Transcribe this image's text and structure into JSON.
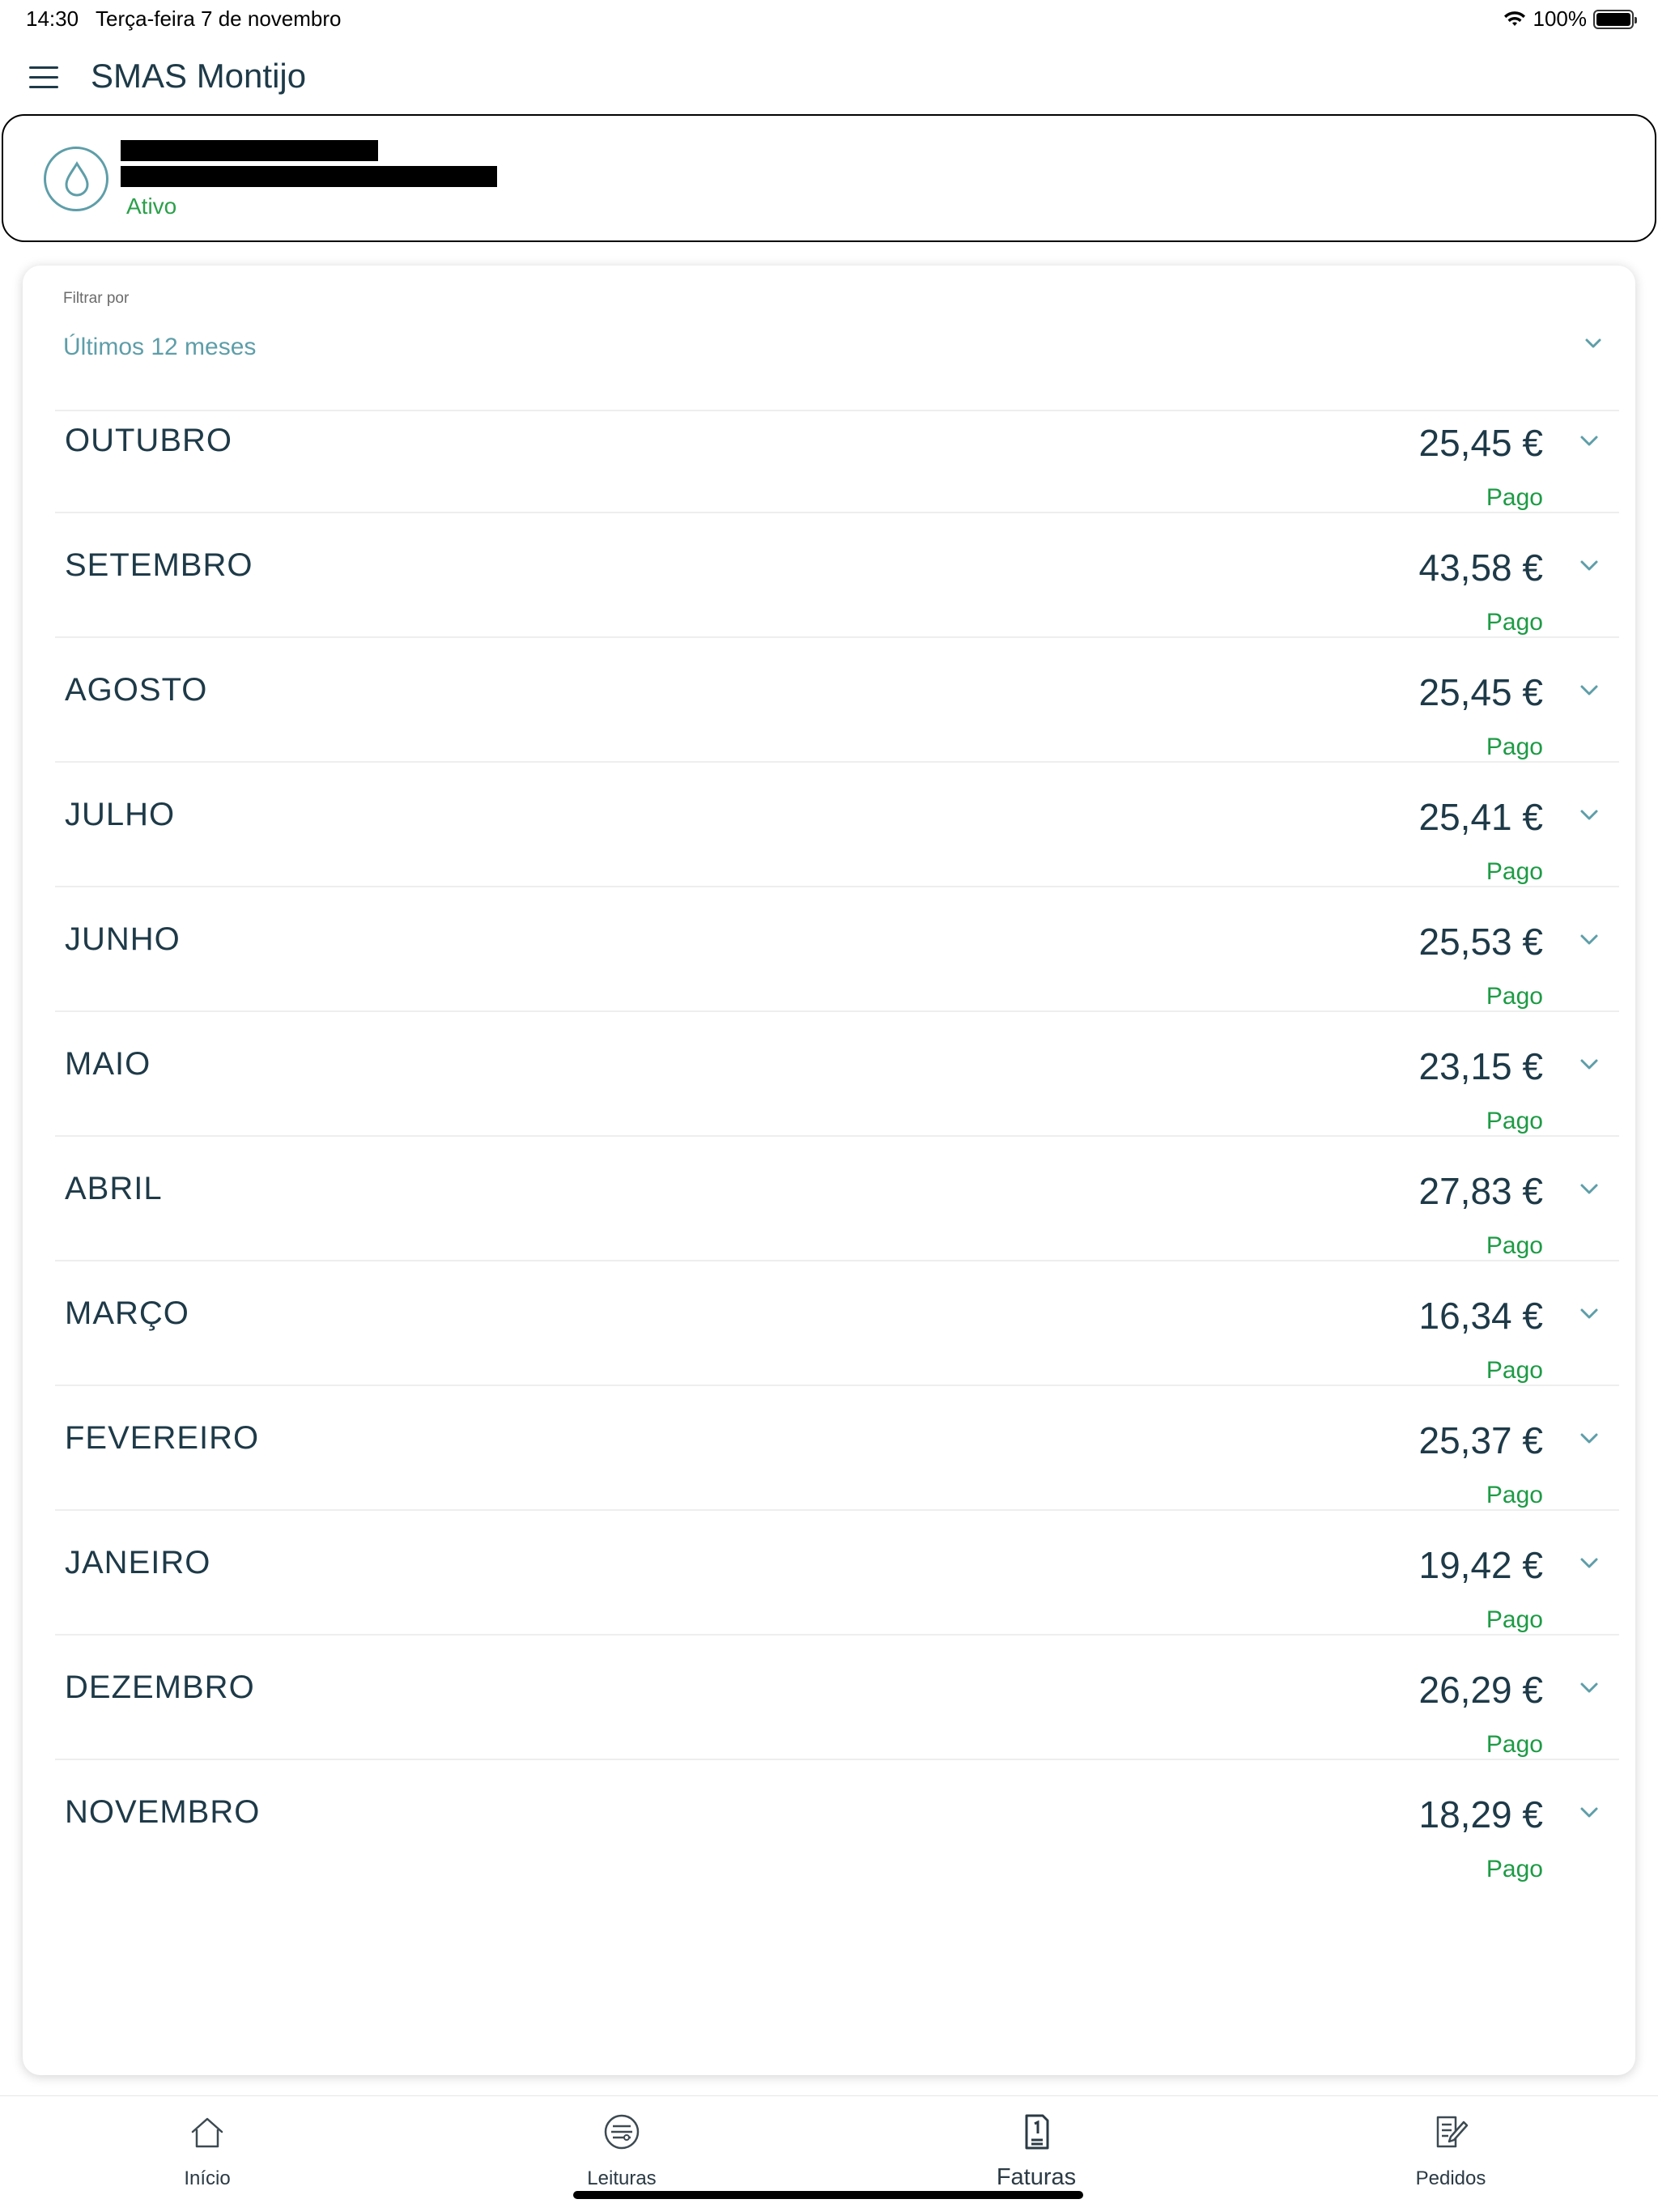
{
  "status_bar": {
    "time": "14:30",
    "date": "Terça-feira 7 de novembro",
    "battery": "100%"
  },
  "header": {
    "title": "SMAS Montijo"
  },
  "account": {
    "status": "Ativo"
  },
  "filter": {
    "label": "Filtrar por",
    "value": "Últimos 12 meses"
  },
  "invoices": [
    {
      "month": "OUTUBRO",
      "amount": "25,45 €",
      "status": "Pago"
    },
    {
      "month": "SETEMBRO",
      "amount": "43,58 €",
      "status": "Pago"
    },
    {
      "month": "AGOSTO",
      "amount": "25,45 €",
      "status": "Pago"
    },
    {
      "month": "JULHO",
      "amount": "25,41 €",
      "status": "Pago"
    },
    {
      "month": "JUNHO",
      "amount": "25,53 €",
      "status": "Pago"
    },
    {
      "month": "MAIO",
      "amount": "23,15 €",
      "status": "Pago"
    },
    {
      "month": "ABRIL",
      "amount": "27,83 €",
      "status": "Pago"
    },
    {
      "month": "MARÇO",
      "amount": "16,34 €",
      "status": "Pago"
    },
    {
      "month": "FEVEREIRO",
      "amount": "25,37 €",
      "status": "Pago"
    },
    {
      "month": "JANEIRO",
      "amount": "19,42 €",
      "status": "Pago"
    },
    {
      "month": "DEZEMBRO",
      "amount": "26,29 €",
      "status": "Pago"
    },
    {
      "month": "NOVEMBRO",
      "amount": "18,29 €",
      "status": "Pago"
    }
  ],
  "tabs": [
    {
      "label": "Início",
      "icon": "home-icon"
    },
    {
      "label": "Leituras",
      "icon": "meter-readings-icon"
    },
    {
      "label": "Faturas",
      "icon": "invoice-icon",
      "active": true
    },
    {
      "label": "Pedidos",
      "icon": "requests-icon"
    }
  ],
  "colors": {
    "accent": "#5e9ea9",
    "paid_green": "#1d9b45",
    "active_green": "#2ba04a",
    "text_dark": "#1e3a48"
  }
}
